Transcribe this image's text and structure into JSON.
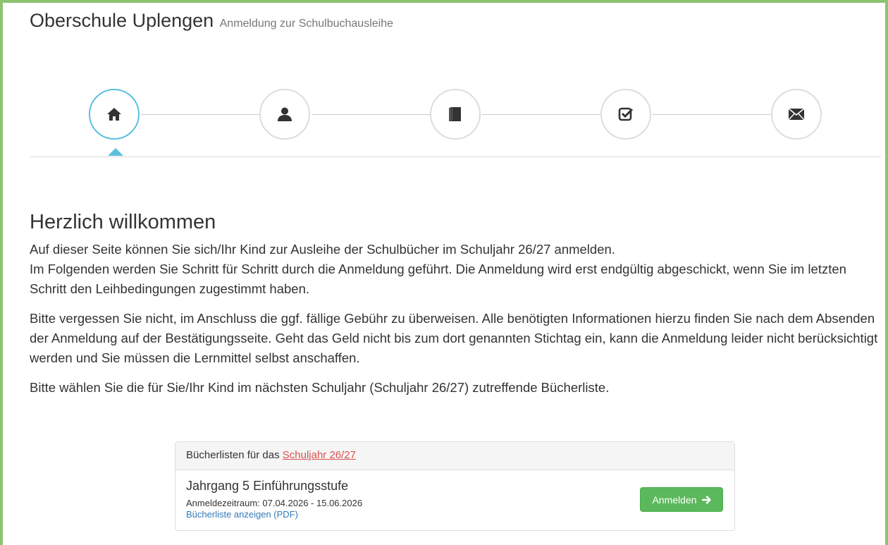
{
  "header": {
    "title": "Oberschule Uplengen",
    "subtitle": "Anmeldung zur Schulbuchausleihe"
  },
  "steps": [
    {
      "icon": "home-icon",
      "active": true
    },
    {
      "icon": "user-icon",
      "active": false
    },
    {
      "icon": "book-icon",
      "active": false
    },
    {
      "icon": "check-square-icon",
      "active": false
    },
    {
      "icon": "envelope-icon",
      "active": false
    }
  ],
  "main": {
    "heading": "Herzlich willkommen",
    "paragraph1_line1": "Auf dieser Seite können Sie sich/Ihr Kind zur Ausleihe der Schulbücher im Schuljahr 26/27 anmelden.",
    "paragraph1_line2": "Im Folgenden werden Sie Schritt für Schritt durch die Anmeldung geführt. Die Anmeldung wird erst endgültig abgeschickt, wenn Sie im letzten Schritt den Leihbedingungen zugestimmt haben.",
    "paragraph2": "Bitte vergessen Sie nicht, im Anschluss die ggf. fällige Gebühr zu überweisen. Alle benötigten Informationen hierzu finden Sie nach dem Absenden der Anmeldung auf der Bestätigungsseite. Geht das Geld nicht bis zum dort genannten Stichtag ein, kann die Anmeldung leider nicht berücksichtigt werden und Sie müssen die Lernmittel selbst anschaffen.",
    "paragraph3": "Bitte wählen Sie die für Sie/Ihr Kind im nächsten Schuljahr (Schuljahr 26/27) zutreffende Bücherliste."
  },
  "panel": {
    "heading_prefix": "Bücherlisten für das",
    "heading_link": "Schuljahr 26/27",
    "grade": "Jahrgang 5 Einführungsstufe",
    "period": "Anmeldezeitraum: 07.04.2026 - 15.06.2026",
    "pdf_link": "Bücherliste anzeigen (PDF)",
    "button_label": "Anmelden",
    "button_icon": "arrow-right-icon"
  },
  "colors": {
    "frame": "#8dc26f",
    "active_step": "#5bc0de",
    "button": "#5cb85c",
    "link": "#337ab7",
    "heading_link": "#d9534f"
  }
}
